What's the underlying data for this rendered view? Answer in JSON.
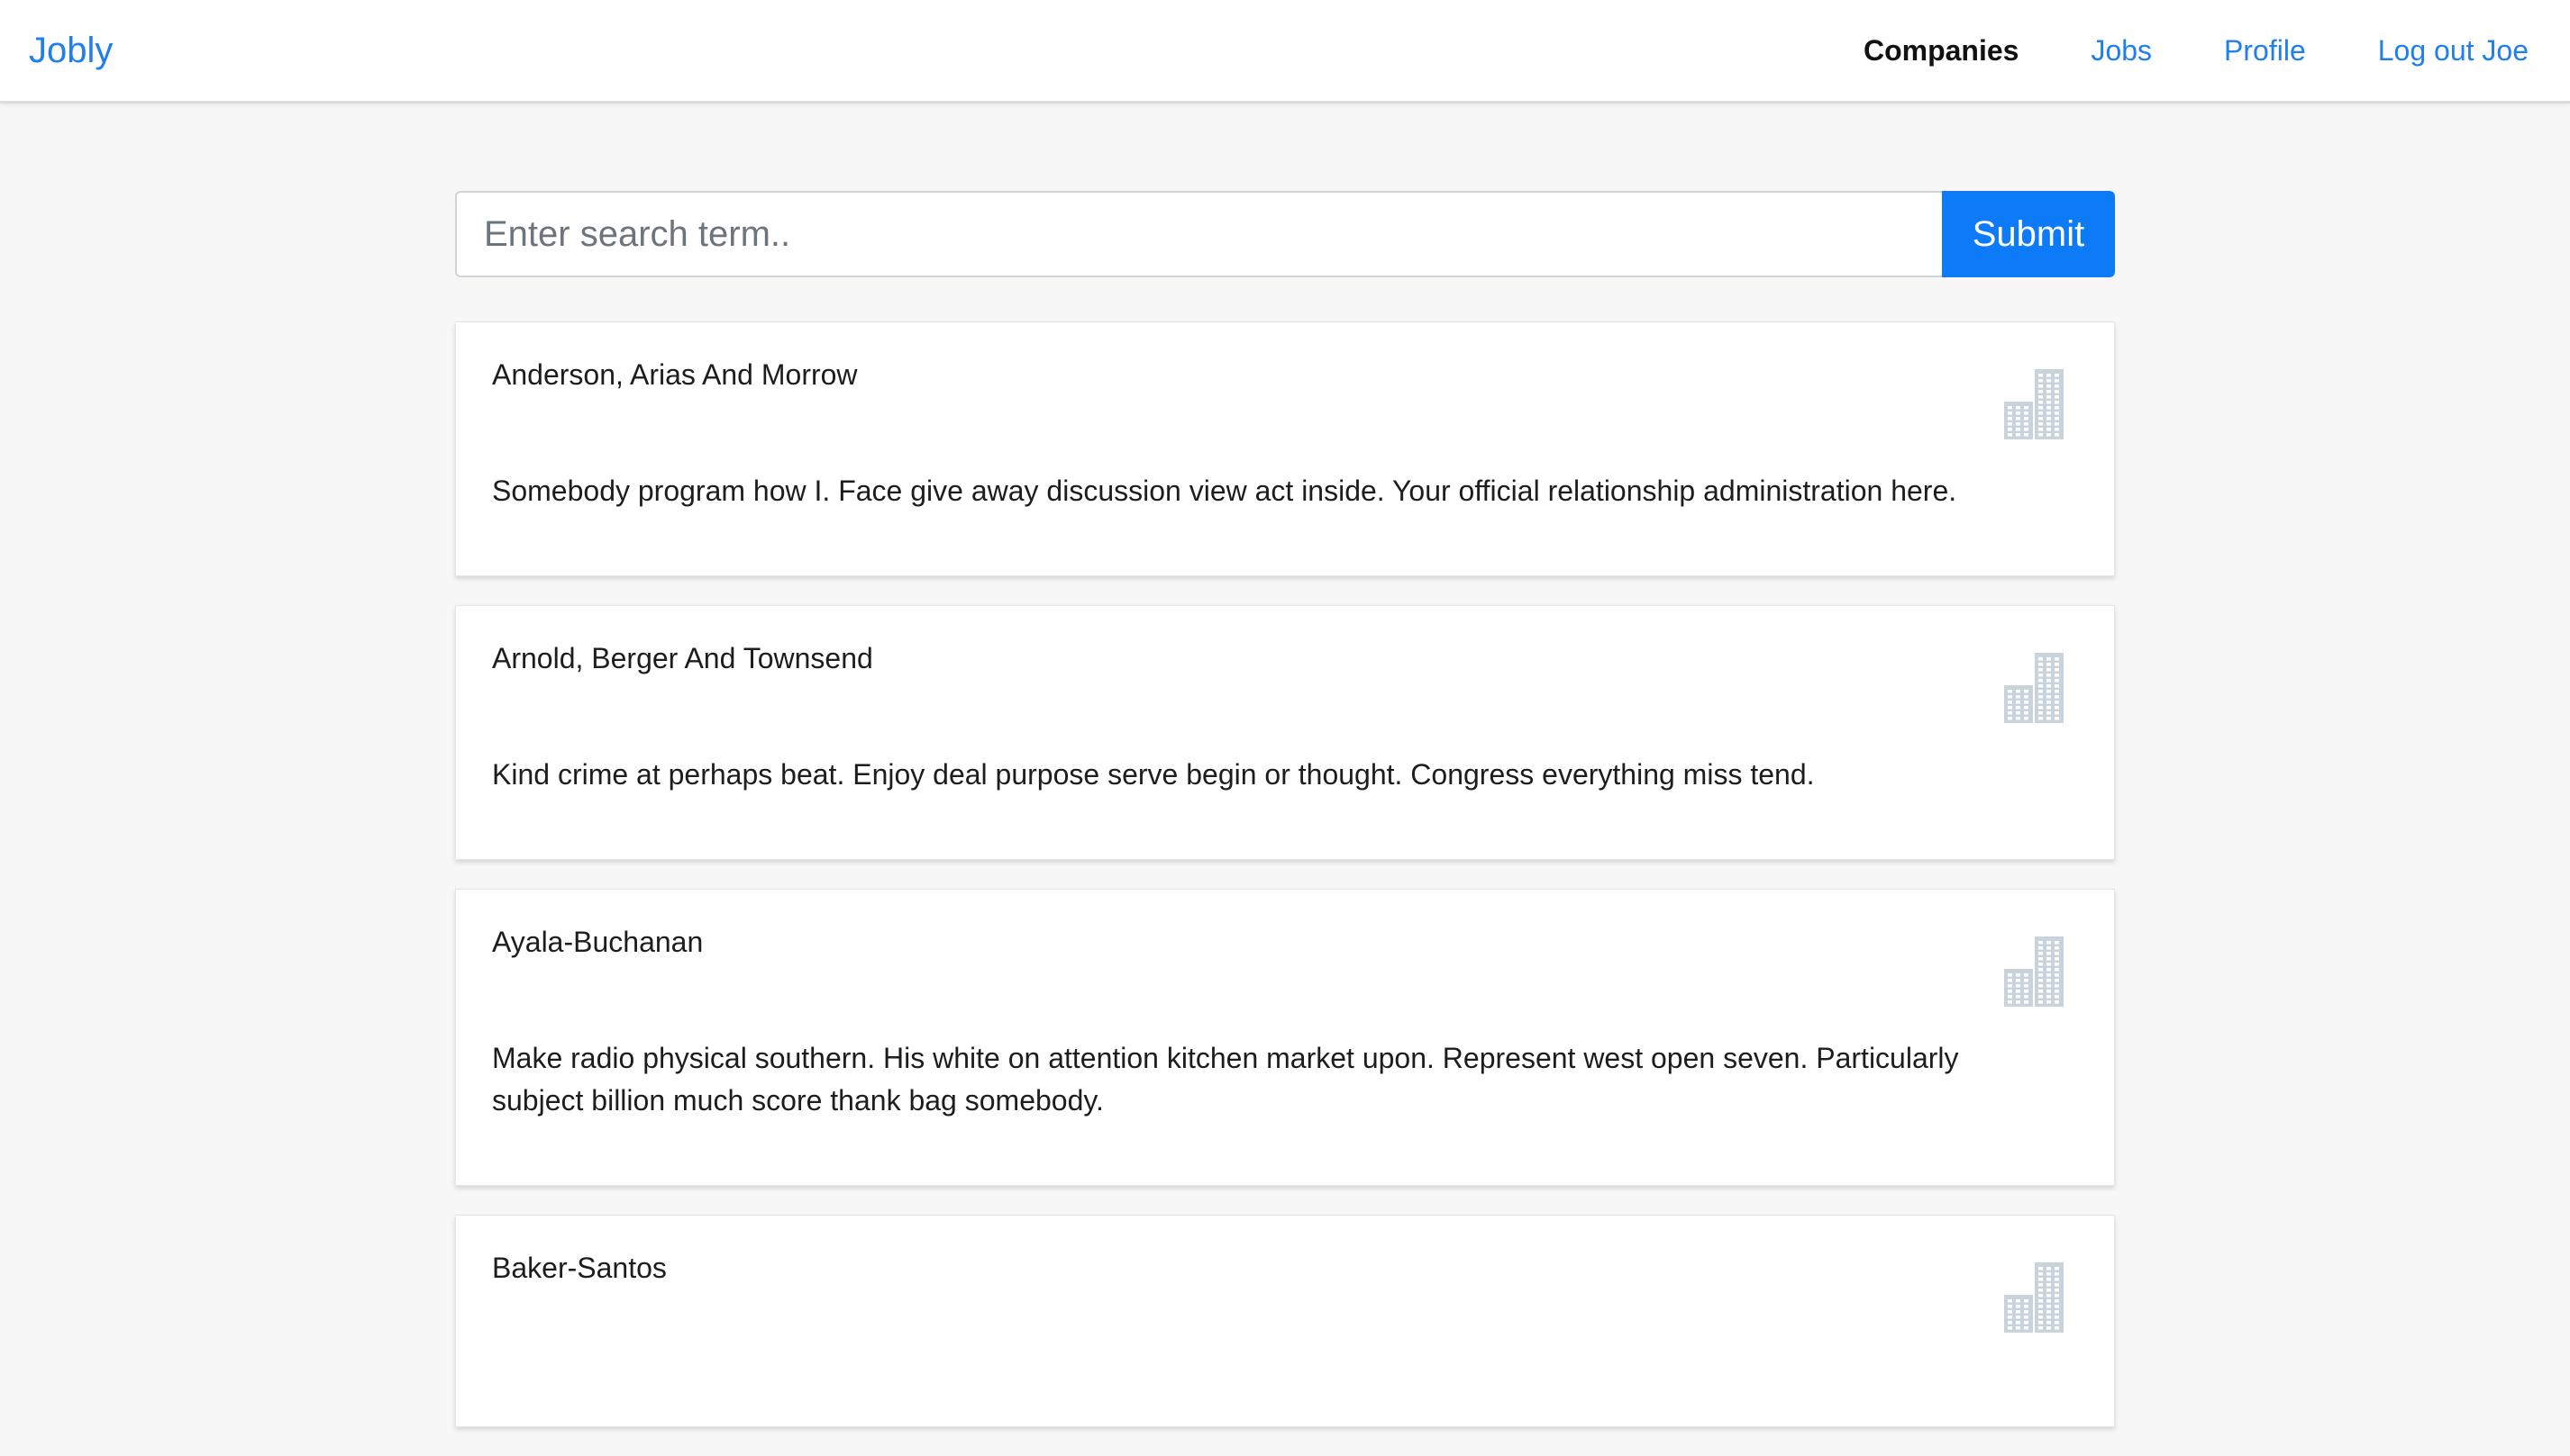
{
  "navbar": {
    "brand": "Jobly",
    "links": [
      {
        "label": "Companies",
        "active": true
      },
      {
        "label": "Jobs",
        "active": false
      },
      {
        "label": "Profile",
        "active": false
      },
      {
        "label": "Log out Joe",
        "active": false
      }
    ]
  },
  "search": {
    "placeholder": "Enter search term..",
    "value": "",
    "submit_label": "Submit"
  },
  "companies": [
    {
      "name": "Anderson, Arias And Morrow",
      "description": "Somebody program how I. Face give away discussion view act inside. Your official relationship administration here.",
      "icon": "building-icon"
    },
    {
      "name": "Arnold, Berger And Townsend",
      "description": "Kind crime at perhaps beat. Enjoy deal purpose serve begin or thought. Congress everything miss tend.",
      "icon": "building-icon"
    },
    {
      "name": "Ayala-Buchanan",
      "description": "Make radio physical southern. His white on attention kitchen market upon. Represent west open seven. Particularly subject billion much score thank bag somebody.",
      "icon": "building-icon"
    },
    {
      "name": "Baker-Santos",
      "description": "",
      "icon": "building-icon"
    }
  ],
  "colors": {
    "brand": "#1f7ef0",
    "submit": "#0d7bf7",
    "background": "#f7f7f7",
    "icon": "#c9d3db"
  }
}
